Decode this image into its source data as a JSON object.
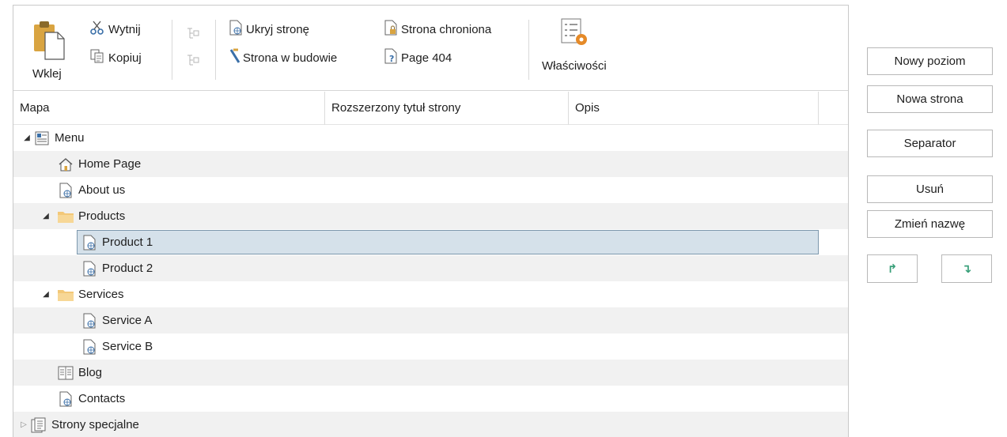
{
  "toolbar": {
    "paste_label": "Wklej",
    "cut_label": "Wytnij",
    "copy_label": "Kopiuj",
    "hide_page_label": "Ukryj stronę",
    "under_construction_label": "Strona w budowie",
    "protected_page_label": "Strona chroniona",
    "page404_label": "Page 404",
    "properties_label": "Właściwości"
  },
  "table": {
    "columns": [
      "Mapa",
      "Rozszerzony tytuł strony",
      "Opis"
    ]
  },
  "tree": {
    "menu": "Menu",
    "home": "Home Page",
    "about": "About us",
    "products": "Products",
    "product1": "Product 1",
    "product2": "Product 2",
    "services": "Services",
    "serviceA": "Service A",
    "serviceB": "Service B",
    "blog": "Blog",
    "contacts": "Contacts",
    "special": "Strony specjalne"
  },
  "buttons": {
    "new_level": "Nowy poziom",
    "new_page": "Nowa strona",
    "separator": "Separator",
    "delete": "Usuń",
    "rename": "Zmień nazwę",
    "move_up": "↱",
    "move_down": "↴"
  }
}
